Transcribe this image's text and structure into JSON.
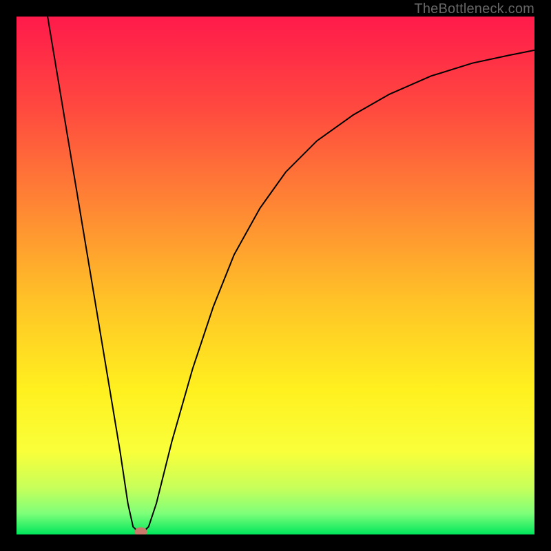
{
  "watermark": "TheBottleneck.com",
  "chart_data": {
    "type": "line",
    "title": "",
    "xlabel": "",
    "ylabel": "",
    "xlim": [
      0,
      100
    ],
    "ylim": [
      0,
      100
    ],
    "background": {
      "type": "vertical_gradient",
      "stops": [
        {
          "offset": 0.0,
          "color": "#ff1a4b"
        },
        {
          "offset": 0.18,
          "color": "#ff4a3f"
        },
        {
          "offset": 0.38,
          "color": "#ff8b33"
        },
        {
          "offset": 0.55,
          "color": "#ffc327"
        },
        {
          "offset": 0.72,
          "color": "#fff01f"
        },
        {
          "offset": 0.84,
          "color": "#f9ff3a"
        },
        {
          "offset": 0.91,
          "color": "#c7ff5a"
        },
        {
          "offset": 0.96,
          "color": "#7dff7a"
        },
        {
          "offset": 1.0,
          "color": "#00e65c"
        }
      ]
    },
    "series": [
      {
        "name": "curve",
        "color": "#000000",
        "width": 2,
        "points": [
          {
            "x": 6,
            "y": 100
          },
          {
            "x": 8,
            "y": 88
          },
          {
            "x": 10,
            "y": 76
          },
          {
            "x": 12,
            "y": 64
          },
          {
            "x": 14,
            "y": 52
          },
          {
            "x": 16,
            "y": 40
          },
          {
            "x": 18,
            "y": 28
          },
          {
            "x": 20,
            "y": 16
          },
          {
            "x": 21.5,
            "y": 6
          },
          {
            "x": 22.5,
            "y": 1.5
          },
          {
            "x": 23.5,
            "y": 0.5
          },
          {
            "x": 24.5,
            "y": 0.5
          },
          {
            "x": 25.5,
            "y": 1.5
          },
          {
            "x": 27,
            "y": 6
          },
          {
            "x": 30,
            "y": 18
          },
          {
            "x": 34,
            "y": 32
          },
          {
            "x": 38,
            "y": 44
          },
          {
            "x": 42,
            "y": 54
          },
          {
            "x": 47,
            "y": 63
          },
          {
            "x": 52,
            "y": 70
          },
          {
            "x": 58,
            "y": 76
          },
          {
            "x": 65,
            "y": 81
          },
          {
            "x": 72,
            "y": 85
          },
          {
            "x": 80,
            "y": 88.5
          },
          {
            "x": 88,
            "y": 91
          },
          {
            "x": 95,
            "y": 92.5
          },
          {
            "x": 100,
            "y": 93.5
          }
        ]
      }
    ],
    "marker": {
      "x": 24,
      "y": 0.5,
      "rx": 1.2,
      "ry": 0.9,
      "color": "#c97a6a"
    }
  }
}
